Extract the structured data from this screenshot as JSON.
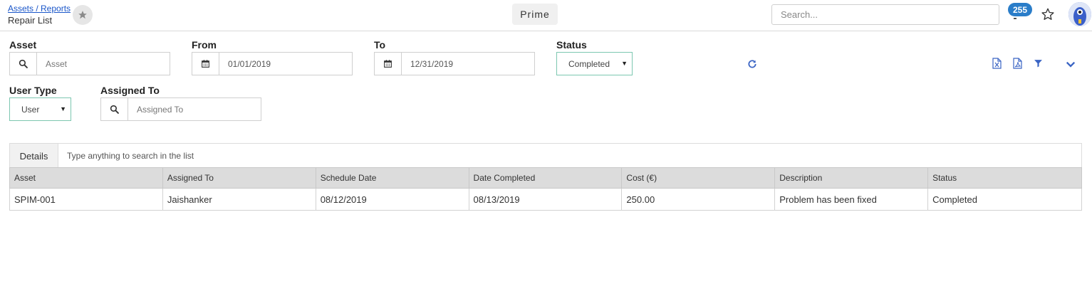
{
  "header": {
    "breadcrumb": "Assets / Reports",
    "title": "Repair List",
    "prime_label": "Prime",
    "search_placeholder": "Search...",
    "notification_count": "255",
    "accent_color": "#2a7dc9"
  },
  "filters": {
    "asset": {
      "label": "Asset",
      "placeholder": "Asset",
      "icon": "search-icon"
    },
    "from": {
      "label": "From",
      "value": "01/01/2019",
      "icon": "calendar-icon"
    },
    "to": {
      "label": "To",
      "value": "12/31/2019",
      "icon": "calendar-icon"
    },
    "status": {
      "label": "Status",
      "value": "Completed"
    },
    "user_type": {
      "label": "User Type",
      "value": "User"
    },
    "assigned_to": {
      "label": "Assigned To",
      "placeholder": "Assigned To",
      "icon": "search-icon"
    }
  },
  "toolbar": {
    "icons": [
      "refresh-icon",
      "excel-export-icon",
      "pdf-export-icon",
      "filter-icon",
      "chevron-down-icon"
    ]
  },
  "list": {
    "tab_label": "Details",
    "search_placeholder": "Type anything to search in the list",
    "columns": [
      "Asset",
      "Assigned To",
      "Schedule Date",
      "Date Completed",
      "Cost (€)",
      "Description",
      "Status"
    ],
    "rows": [
      [
        "SPIM-001",
        "Jaishanker",
        "08/12/2019",
        "08/13/2019",
        "250.00",
        "Problem has been fixed",
        "Completed"
      ]
    ]
  }
}
